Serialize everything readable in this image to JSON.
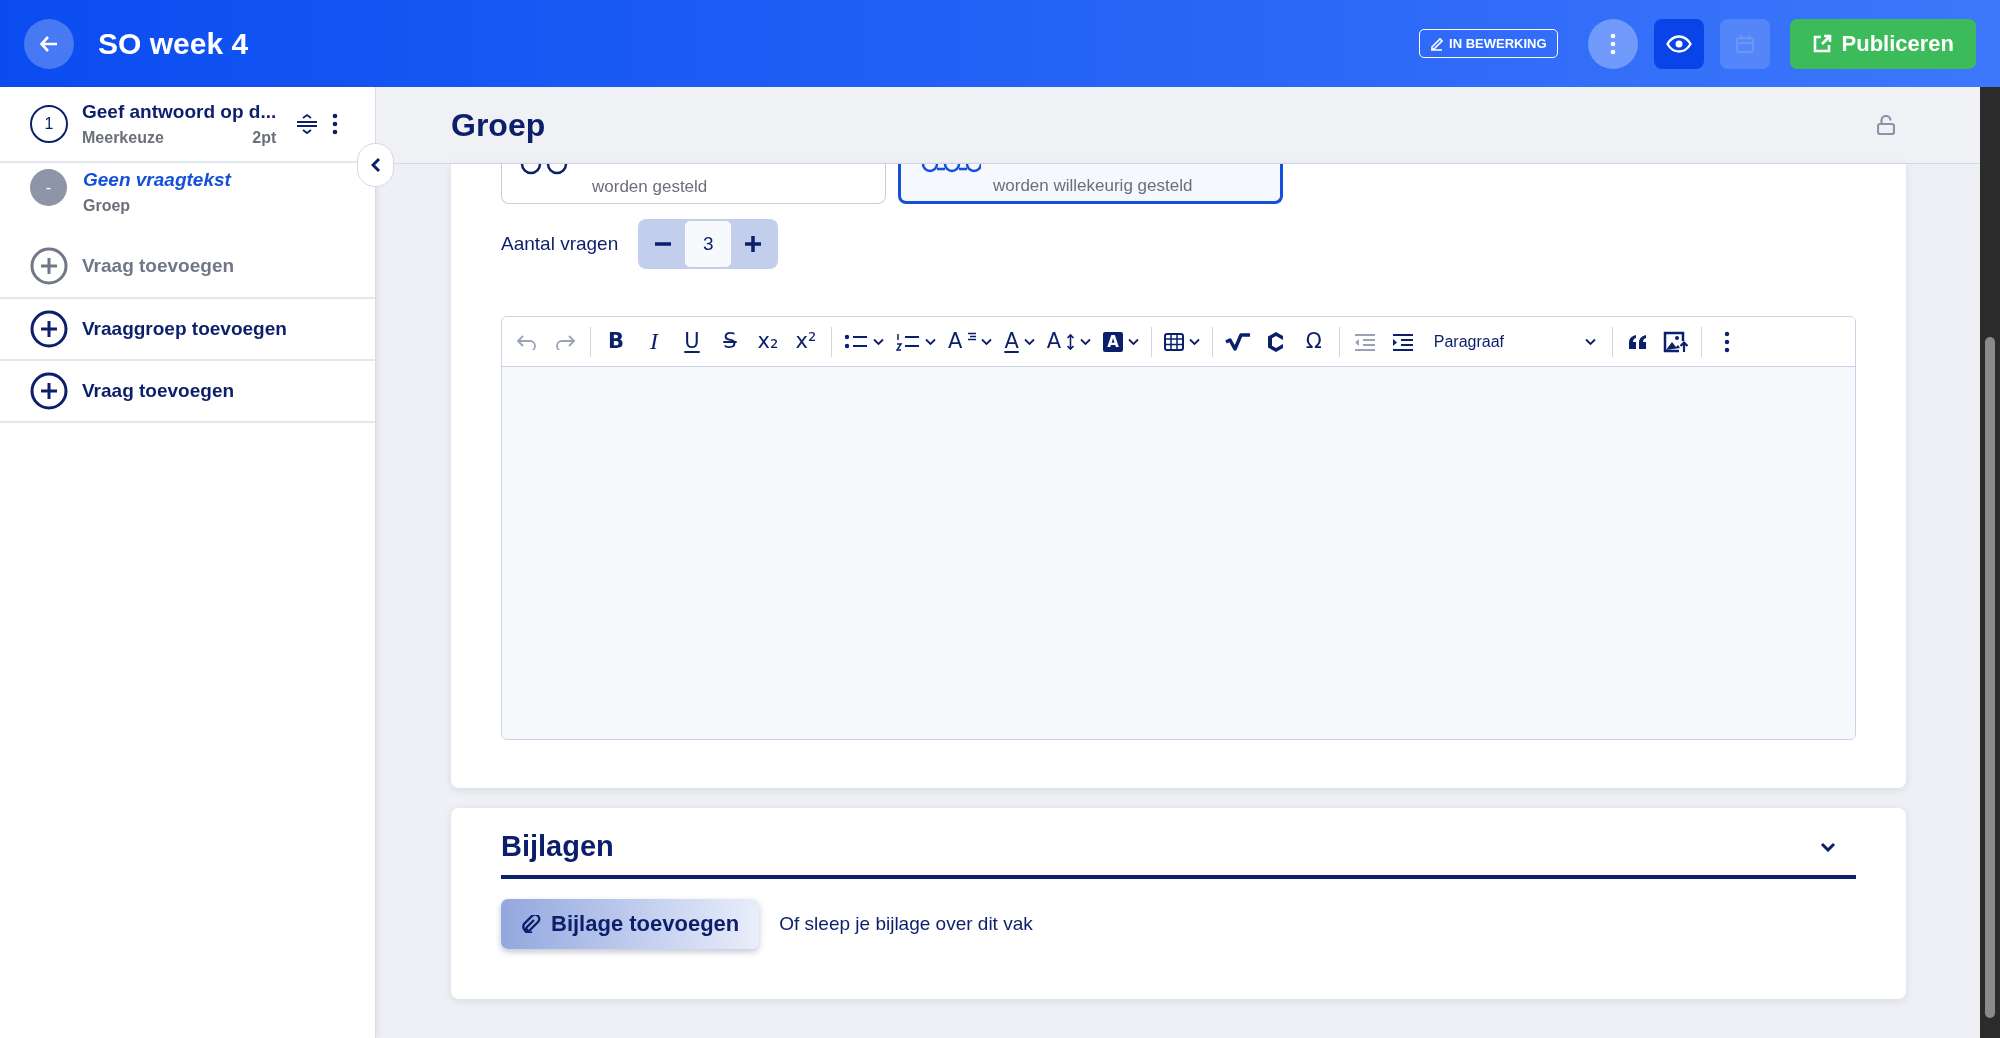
{
  "header": {
    "title": "SO week 4",
    "status": "IN BEWERKING",
    "publish": "Publiceren",
    "schedule_disabled": true
  },
  "sidebar": {
    "items": [
      {
        "kind": "question",
        "number": "1",
        "title": "Geef antwoord op d...",
        "type": "Meerkeuze",
        "points": "2pt"
      },
      {
        "kind": "group",
        "marker": "-",
        "title": "Geen vraagtekst",
        "type": "Groep",
        "children": [
          {
            "kind": "add",
            "label": "Vraag toevoegen"
          }
        ]
      },
      {
        "kind": "add",
        "label": "Vraaggroep toevoegen"
      },
      {
        "kind": "add",
        "label": "Vraag toevoegen"
      }
    ]
  },
  "panel": {
    "title": "Groep",
    "options": [
      {
        "description": "worden gesteld",
        "selected": false
      },
      {
        "description": "worden willekeurig gesteld",
        "selected": true
      }
    ],
    "count": {
      "label": "Aantal vragen",
      "value": "3"
    },
    "toolbar": [
      [
        {
          "kind": "undo",
          "disabled": true
        },
        {
          "kind": "redo",
          "disabled": true
        }
      ],
      [
        {
          "kind": "bold",
          "glyph": "B",
          "disabled": false
        },
        {
          "kind": "italic",
          "glyph": "I",
          "disabled": false
        },
        {
          "kind": "underline",
          "glyph": "U",
          "disabled": false
        },
        {
          "kind": "strike",
          "glyph": "S",
          "disabled": false
        },
        {
          "kind": "plain",
          "glyph": "x₂",
          "disabled": false
        },
        {
          "kind": "plain",
          "glyph": "x²",
          "disabled": false
        }
      ],
      [
        {
          "kind": "bullets",
          "disabled": false,
          "dropdown": true
        },
        {
          "kind": "numbers",
          "disabled": false,
          "dropdown": true
        },
        {
          "kind": "format",
          "glyph": "A",
          "disabled": false,
          "dropdown": true
        },
        {
          "kind": "color",
          "glyph": "A",
          "disabled": false,
          "dropdown": true
        },
        {
          "kind": "size",
          "glyph": "A",
          "disabled": false,
          "dropdown": true
        },
        {
          "kind": "highlight",
          "glyph": "A",
          "disabled": false,
          "dropdown": true
        }
      ],
      [
        {
          "kind": "table",
          "disabled": false,
          "dropdown": true
        }
      ],
      [
        {
          "kind": "root",
          "disabled": false
        },
        {
          "kind": "hexc",
          "disabled": false
        },
        {
          "kind": "plain",
          "glyph": "Ω",
          "disabled": false
        }
      ],
      [
        {
          "kind": "outdent",
          "disabled": true
        },
        {
          "kind": "indent",
          "disabled": false
        },
        {
          "kind": "select",
          "value": "Paragraaf",
          "disabled": false,
          "dropdown": true
        }
      ],
      [
        {
          "kind": "quote",
          "disabled": false
        },
        {
          "kind": "image",
          "disabled": false
        }
      ],
      [
        {
          "kind": "more",
          "disabled": false
        }
      ]
    ]
  },
  "attachments": {
    "title": "Bijlagen",
    "button": "Bijlage toevoegen",
    "hint": "Of sleep je bijlage over dit vak"
  }
}
